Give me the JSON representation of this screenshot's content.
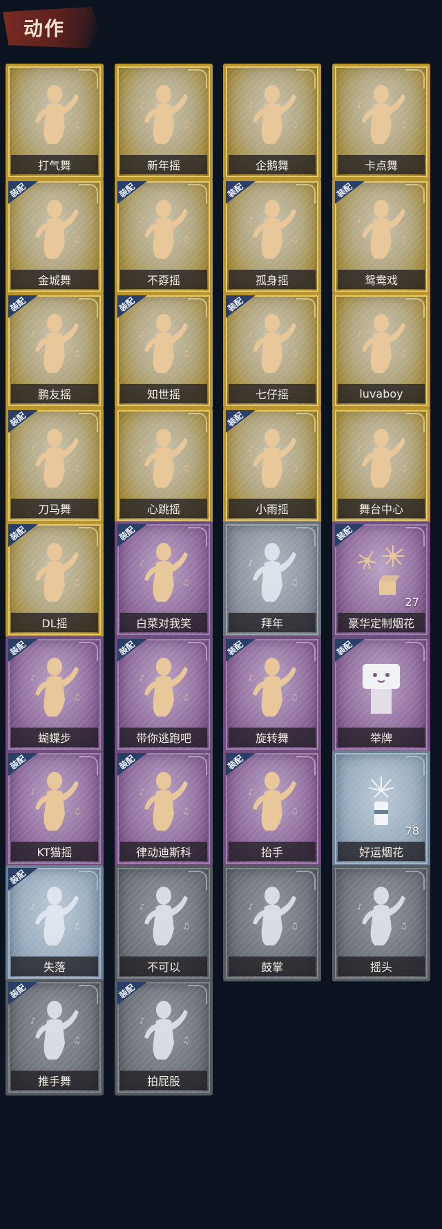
{
  "section": {
    "title": "动作"
  },
  "equip_label": "装配",
  "colors": {
    "gold": "#b8952d",
    "purple": "#6f4e7e",
    "silver": "#6c737d",
    "bluegray": "#6d8194",
    "gray": "#565b62",
    "equip_badge": "#2a3f67",
    "figure": "#e8c79a"
  },
  "emotes": [
    {
      "name": "打气舞",
      "rarity": "gold",
      "equipped": false,
      "icon": "dance-figure-icon"
    },
    {
      "name": "新年摇",
      "rarity": "gold",
      "equipped": false,
      "icon": "dance-figure-icon"
    },
    {
      "name": "企鹅舞",
      "rarity": "gold",
      "equipped": false,
      "icon": "dance-figure-icon"
    },
    {
      "name": "卡点舞",
      "rarity": "gold",
      "equipped": false,
      "icon": "dance-figure-icon"
    },
    {
      "name": "金城舞",
      "rarity": "gold",
      "equipped": true,
      "icon": "dance-figure-icon"
    },
    {
      "name": "不孬摇",
      "rarity": "gold",
      "equipped": true,
      "icon": "dance-figure-icon"
    },
    {
      "name": "孤身摇",
      "rarity": "gold",
      "equipped": true,
      "icon": "dance-figure-icon"
    },
    {
      "name": "鸳鸯戏",
      "rarity": "gold",
      "equipped": true,
      "icon": "dance-figure-icon"
    },
    {
      "name": "鹏友摇",
      "rarity": "gold",
      "equipped": true,
      "icon": "dance-figure-icon"
    },
    {
      "name": "知世摇",
      "rarity": "gold",
      "equipped": true,
      "icon": "dance-figure-icon"
    },
    {
      "name": "七仔摇",
      "rarity": "gold",
      "equipped": true,
      "icon": "dance-figure-icon"
    },
    {
      "name": "luvaboy",
      "rarity": "gold",
      "equipped": false,
      "icon": "dance-figure-icon"
    },
    {
      "name": "刀马舞",
      "rarity": "gold",
      "equipped": true,
      "icon": "dance-figure-icon"
    },
    {
      "name": "心跳摇",
      "rarity": "gold",
      "equipped": false,
      "icon": "dance-figure-icon"
    },
    {
      "name": "小雨摇",
      "rarity": "gold",
      "equipped": true,
      "icon": "dance-figure-icon"
    },
    {
      "name": "舞台中心",
      "rarity": "gold",
      "equipped": false,
      "icon": "dance-figure-icon"
    },
    {
      "name": "DL摇",
      "rarity": "gold",
      "equipped": true,
      "icon": "dance-figure-icon"
    },
    {
      "name": "白菜对我笑",
      "rarity": "purple",
      "equipped": true,
      "icon": "dance-figure-icon"
    },
    {
      "name": "拜年",
      "rarity": "silver",
      "equipped": false,
      "icon": "bow-figure-icon"
    },
    {
      "name": "豪华定制烟花",
      "rarity": "purple",
      "equipped": true,
      "icon": "fireworks-icon",
      "count": "27"
    },
    {
      "name": "蝴蝶步",
      "rarity": "purple",
      "equipped": true,
      "icon": "dance-figure-icon"
    },
    {
      "name": "带你逃跑吧",
      "rarity": "purple",
      "equipped": true,
      "icon": "dance-figure-icon"
    },
    {
      "name": "旋转舞",
      "rarity": "purple",
      "equipped": true,
      "icon": "dance-figure-icon"
    },
    {
      "name": "举牌",
      "rarity": "purple",
      "equipped": true,
      "icon": "sign-holder-icon"
    },
    {
      "name": "KT猫摇",
      "rarity": "purple",
      "equipped": true,
      "icon": "dance-figure-icon"
    },
    {
      "name": "律动迪斯科",
      "rarity": "purple",
      "equipped": true,
      "icon": "dance-figure-icon"
    },
    {
      "name": "抬手",
      "rarity": "purple",
      "equipped": true,
      "icon": "raise-hand-icon"
    },
    {
      "name": "好运烟花",
      "rarity": "bluegray",
      "equipped": false,
      "icon": "firework-rocket-icon",
      "count": "78"
    },
    {
      "name": "失落",
      "rarity": "bluegray",
      "equipped": true,
      "icon": "kneeling-figure-icon"
    },
    {
      "name": "不可以",
      "rarity": "gray",
      "equipped": false,
      "icon": "finger-wag-icon"
    },
    {
      "name": "鼓掌",
      "rarity": "gray",
      "equipped": false,
      "icon": "clapping-hands-icon"
    },
    {
      "name": "摇头",
      "rarity": "gray",
      "equipped": false,
      "icon": "head-shake-icon"
    },
    {
      "name": "推手舞",
      "rarity": "gray",
      "equipped": true,
      "icon": "push-hands-icon"
    },
    {
      "name": "拍屁股",
      "rarity": "gray",
      "equipped": true,
      "icon": "slap-butt-icon"
    }
  ]
}
